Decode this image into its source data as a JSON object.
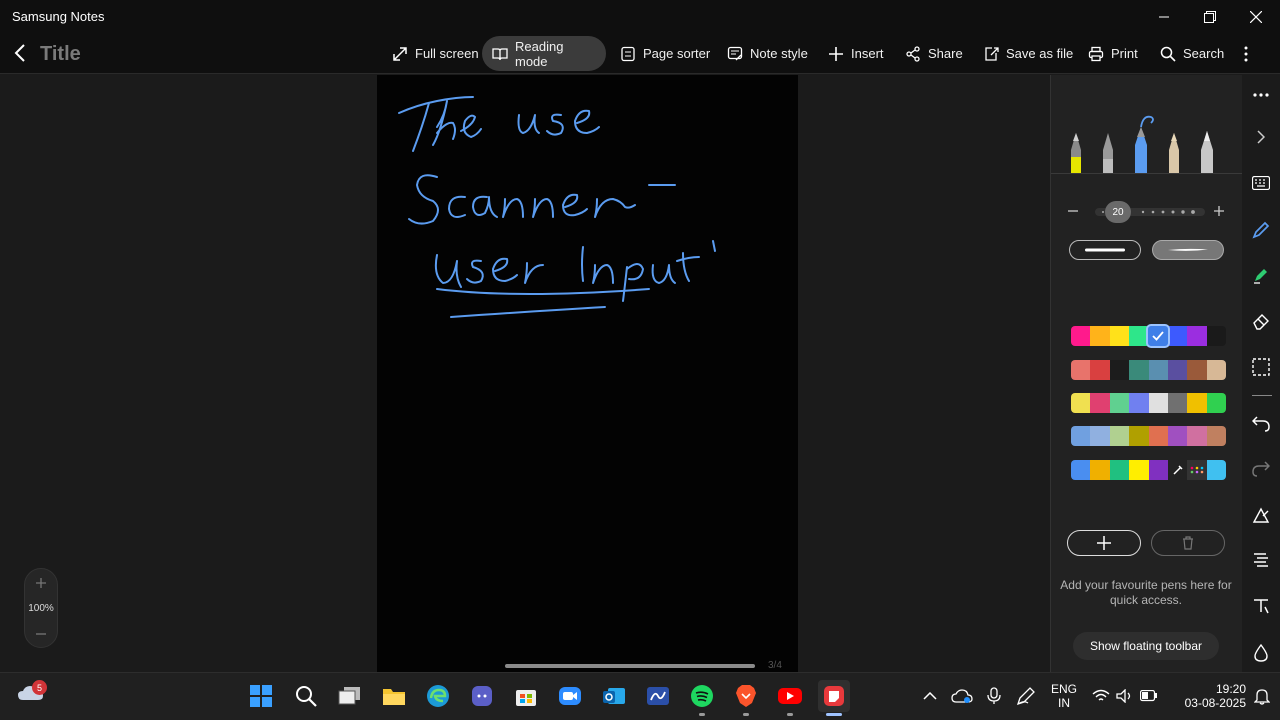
{
  "window": {
    "title": "Samsung Notes"
  },
  "note": {
    "title": "Title",
    "page_indicator": "3/4",
    "zoom": "100%"
  },
  "handwriting": {
    "text": "The use Scanner - User Input",
    "ink_color": "#5b9cf0"
  },
  "toolbar": {
    "full_screen": "Full screen",
    "reading_mode": "Reading mode",
    "page_sorter": "Page sorter",
    "note_style": "Note style",
    "insert": "Insert",
    "share": "Share",
    "save_as_file": "Save as file",
    "print": "Print",
    "search": "Search"
  },
  "pen_panel": {
    "size_value": "20",
    "selected_color": "#3f7fe8",
    "favorites_hint": "Add your favourite pens here for quick access.",
    "floating_toolbar_label": "Show floating toolbar",
    "palette": [
      [
        "#ff1a8c",
        "#ffb31a",
        "#ffe11a",
        "#2ee68a",
        "#3f7fe8",
        "#3d5afe",
        "#9b2ee0",
        "#1a1a1a"
      ],
      [
        "#e8736b",
        "#d94040",
        "#1c1c1c",
        "#3a8a7a",
        "#5a8fb0",
        "#5a4fa0",
        "#9a5a3a",
        "#d7b896"
      ],
      [
        "#f0e050",
        "#e04070",
        "#60d090",
        "#7080f0",
        "#e0e0e0",
        "#707070",
        "#f0c000",
        "#30d050"
      ],
      [
        "#70a0e0",
        "#90b0e0",
        "#b0d090",
        "#b0a000",
        "#e07050",
        "#a050c0",
        "#d070a0",
        "#c08060"
      ],
      [
        "#4a8ef0",
        "#f0b000",
        "#20c080",
        "#ffee00",
        "#8030c0",
        "#222222",
        "#333333",
        "#40c0f0"
      ]
    ]
  },
  "taskbar": {
    "weather_badge": "5",
    "language_line1": "ENG",
    "language_line2": "IN",
    "time": "19:20",
    "date": "03-08-2025"
  }
}
